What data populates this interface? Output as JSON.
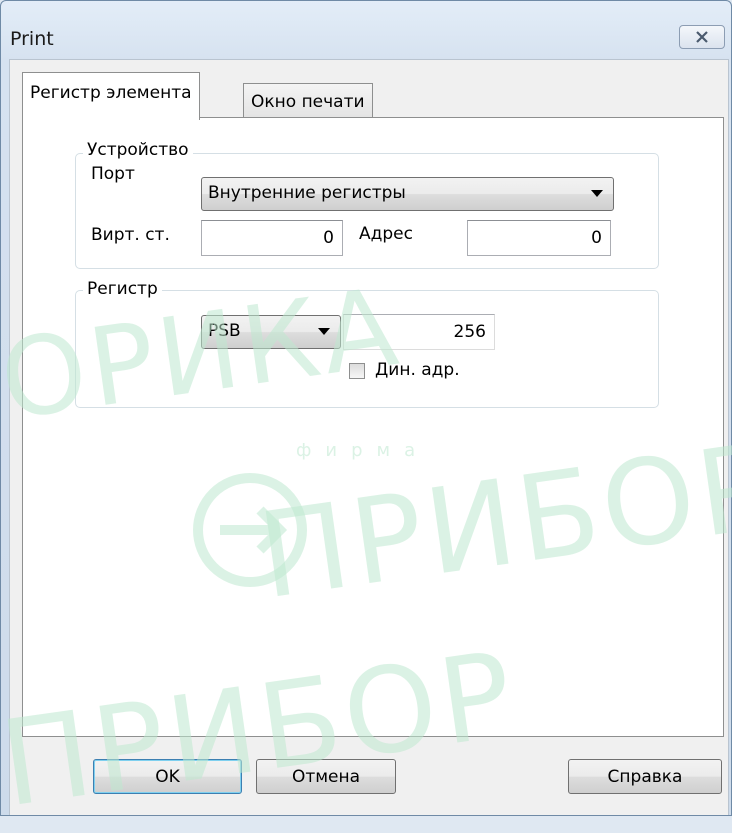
{
  "window": {
    "title": "Print"
  },
  "tabs": [
    {
      "label": "Регистр элемента",
      "active": true
    },
    {
      "label": "Окно печати",
      "active": false
    }
  ],
  "device_group": {
    "label": "Устройство",
    "port_label": "Порт",
    "port_value": "Внутренние регистры",
    "virt_label": "Вирт. ст.",
    "virt_value": "0",
    "address_label": "Адрес",
    "address_value": "0"
  },
  "register_group": {
    "label": "Регистр",
    "type_value": "PSB",
    "number_value": "256",
    "dyn_addr_label": "Дин. адр.",
    "dyn_addr_checked": false
  },
  "buttons": {
    "ok": "OK",
    "cancel": "Отмена",
    "help": "Справка"
  },
  "watermark": {
    "line1": "ПРИБОР",
    "line2": "фирма",
    "line3": "ПРИБОР",
    "line4": "ОРИКА"
  },
  "colors": {
    "watermark": "#bfe9d0",
    "tab_border": "#8e8f8f",
    "default_button_border": "#3c7fb1"
  }
}
